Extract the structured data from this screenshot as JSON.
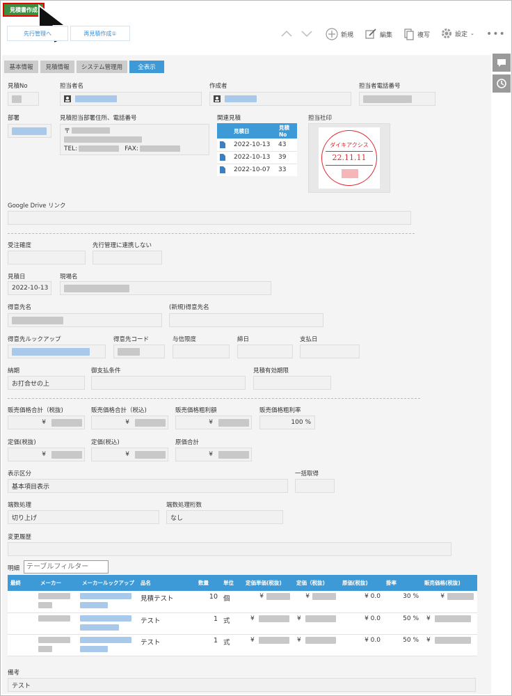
{
  "header": {
    "primary_action": "見積書作成",
    "btn_advance": "先行管理へ",
    "btn_recreate": "再見積作成①",
    "new_label": "新規",
    "edit_label": "編集",
    "copy_label": "複写",
    "settings_label": "設定"
  },
  "tabs": [
    {
      "label": "基本情報"
    },
    {
      "label": "見積情報"
    },
    {
      "label": "システム管理用"
    },
    {
      "label": "全表示"
    }
  ],
  "basic": {
    "quote_no_label": "見積No",
    "staff_label": "担当者名",
    "creator_label": "作成者",
    "staff_phone_label": "担当者電話番号",
    "dept_label": "部署",
    "dept_addr_label": "見積担当部署住所、電話番号",
    "postal_mark": "〒",
    "tel_label": "TEL:",
    "fax_label": "FAX:",
    "related_label": "関連見積",
    "related_headers": [
      "見積日",
      "見積No"
    ],
    "related_rows": [
      {
        "date": "2022-10-13",
        "no": "43"
      },
      {
        "date": "2022-10-13",
        "no": "39"
      },
      {
        "date": "2022-10-07",
        "no": "33"
      }
    ],
    "seal_label": "担当社印",
    "seal_company": "ダイキアクシス",
    "seal_date": "22.11.11",
    "gdrive_label": "Google Drive リンク"
  },
  "order": {
    "confirm_label": "受注確度",
    "no_link_label": "先行管理に連携しない",
    "date_label": "見積日",
    "date_value": "2022-10-13",
    "site_label": "現場名",
    "customer_label": "得意先名",
    "new_customer_label": "(新規)得意先名",
    "lookup_label": "得意先ルックアップ",
    "code_label": "得意先コード",
    "credit_label": "与信限度",
    "closing_label": "締日",
    "payday_label": "支払日",
    "delivery_label": "納期",
    "delivery_value": "お打合せの上",
    "payment_label": "御支払条件",
    "validity_label": "見積有効期限"
  },
  "prices": {
    "total_ex_label": "販売価格合計（税抜)",
    "total_in_label": "販売価格合計（税込)",
    "gross_label": "販売価格粗利額",
    "rate_label": "販売価格粗利率",
    "rate_value": "100 %",
    "list_ex_label": "定価(税抜)",
    "list_in_label": "定価(税込)",
    "cost_label": "原価合計",
    "yen": "¥"
  },
  "display": {
    "type_label": "表示区分",
    "type_value": "基本項目表示",
    "bulk_label": "一括取得",
    "rounding_label": "端数処理",
    "rounding_value": "切り上げ",
    "digits_label": "端数処理桁数",
    "digits_value": "なし",
    "history_label": "変更履歴"
  },
  "detail": {
    "label": "明細",
    "filter_placeholder": "テーブルフィルター",
    "headers": [
      "最終",
      "メーカー",
      "メーカールックアップ",
      "品名",
      "数量",
      "単位",
      "定価単価(税抜)",
      "定価（税抜)",
      "原価(税抜)",
      "掛率",
      "販売価格(税抜)"
    ],
    "rows": [
      {
        "name": "見積テスト",
        "qty": "10",
        "unit": "個",
        "cost": "¥ 0.0",
        "rate": "30 %"
      },
      {
        "name": "テスト",
        "qty": "1",
        "unit": "式",
        "cost": "¥ 0.0",
        "rate": "50 %"
      },
      {
        "name": "テスト",
        "qty": "1",
        "unit": "式",
        "cost": "¥ 0.0",
        "rate": "50 %"
      }
    ]
  },
  "remarks": {
    "label": "備考",
    "value": "テスト"
  },
  "colors": {
    "accent": "#3e9ad6",
    "primary_button": "#3e8e41",
    "seal_red": "#e0292e"
  }
}
